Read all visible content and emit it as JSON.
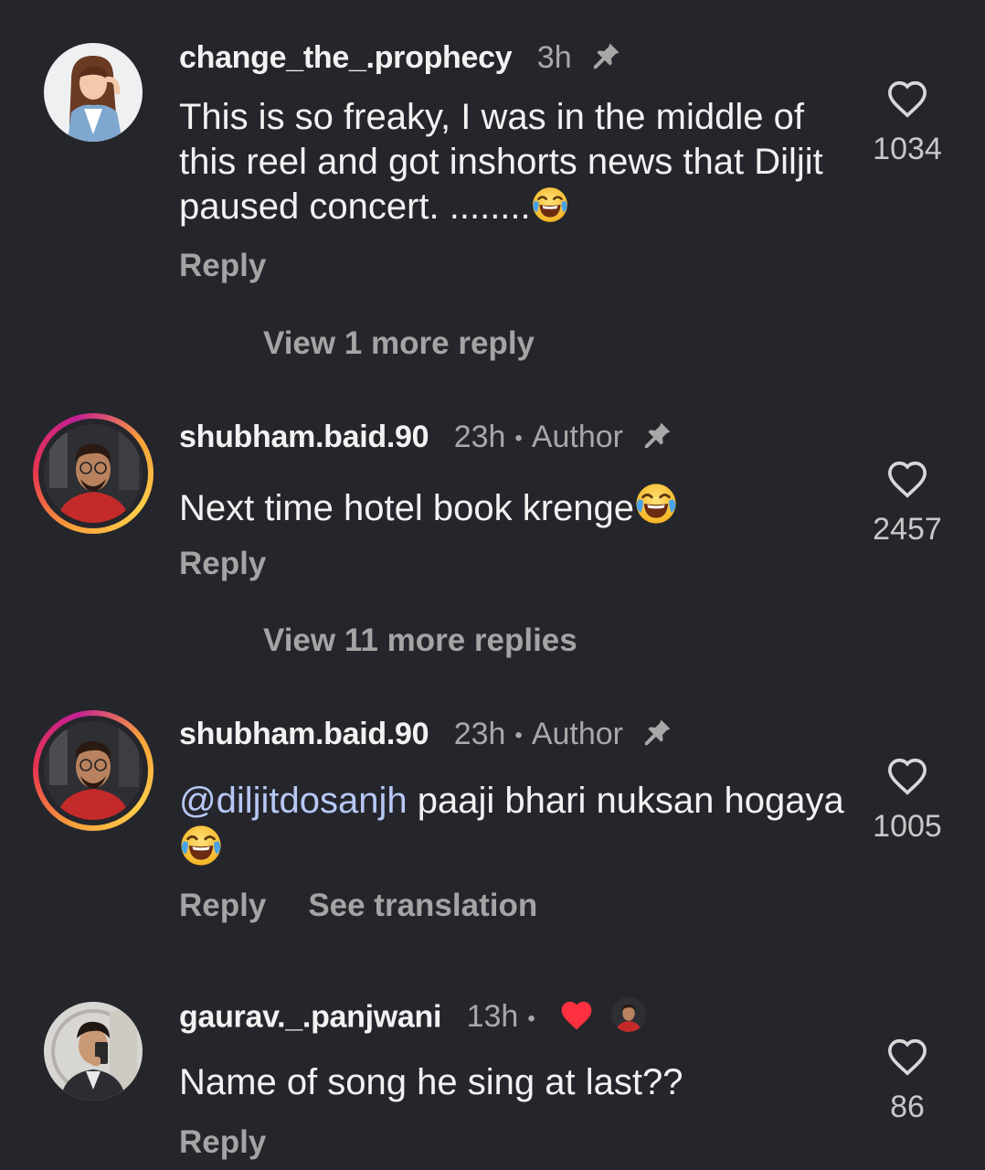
{
  "comments": [
    {
      "username": "change_the_.prophecy",
      "time": "3h",
      "text": "This is so freaky, I was in the middle of this reel and got inshorts news that Diljit paused concert. ........",
      "likes": "1034",
      "reply_label": "Reply",
      "view_more": "View 1 more reply"
    },
    {
      "username": "shubham.baid.90",
      "time": "23h",
      "badge": "Author",
      "text": "Next time hotel book krenge",
      "likes": "2457",
      "reply_label": "Reply",
      "view_more": "View 11 more replies"
    },
    {
      "username": "shubham.baid.90",
      "time": "23h",
      "badge": "Author",
      "mention": "@diljitdosanjh",
      "text": " paaji bhari nuksan hogaya",
      "likes": "1005",
      "reply_label": "Reply",
      "translate_label": "See translation"
    },
    {
      "username": "gaurav._.panjwani",
      "time": "13h",
      "text": "Name of song he sing at last??",
      "likes": "86",
      "reply_label": "Reply"
    }
  ],
  "icons": {
    "pin": "pin-icon",
    "heart": "heart-icon",
    "emoji": "laughing-tears-emoji",
    "liked_by_author": "red-heart-icon"
  },
  "colors": {
    "background": "#25262b",
    "text": "#f2f2f2",
    "muted": "#a8a8a8",
    "mention": "#b7c8f6",
    "red_heart": "#ff3040"
  }
}
